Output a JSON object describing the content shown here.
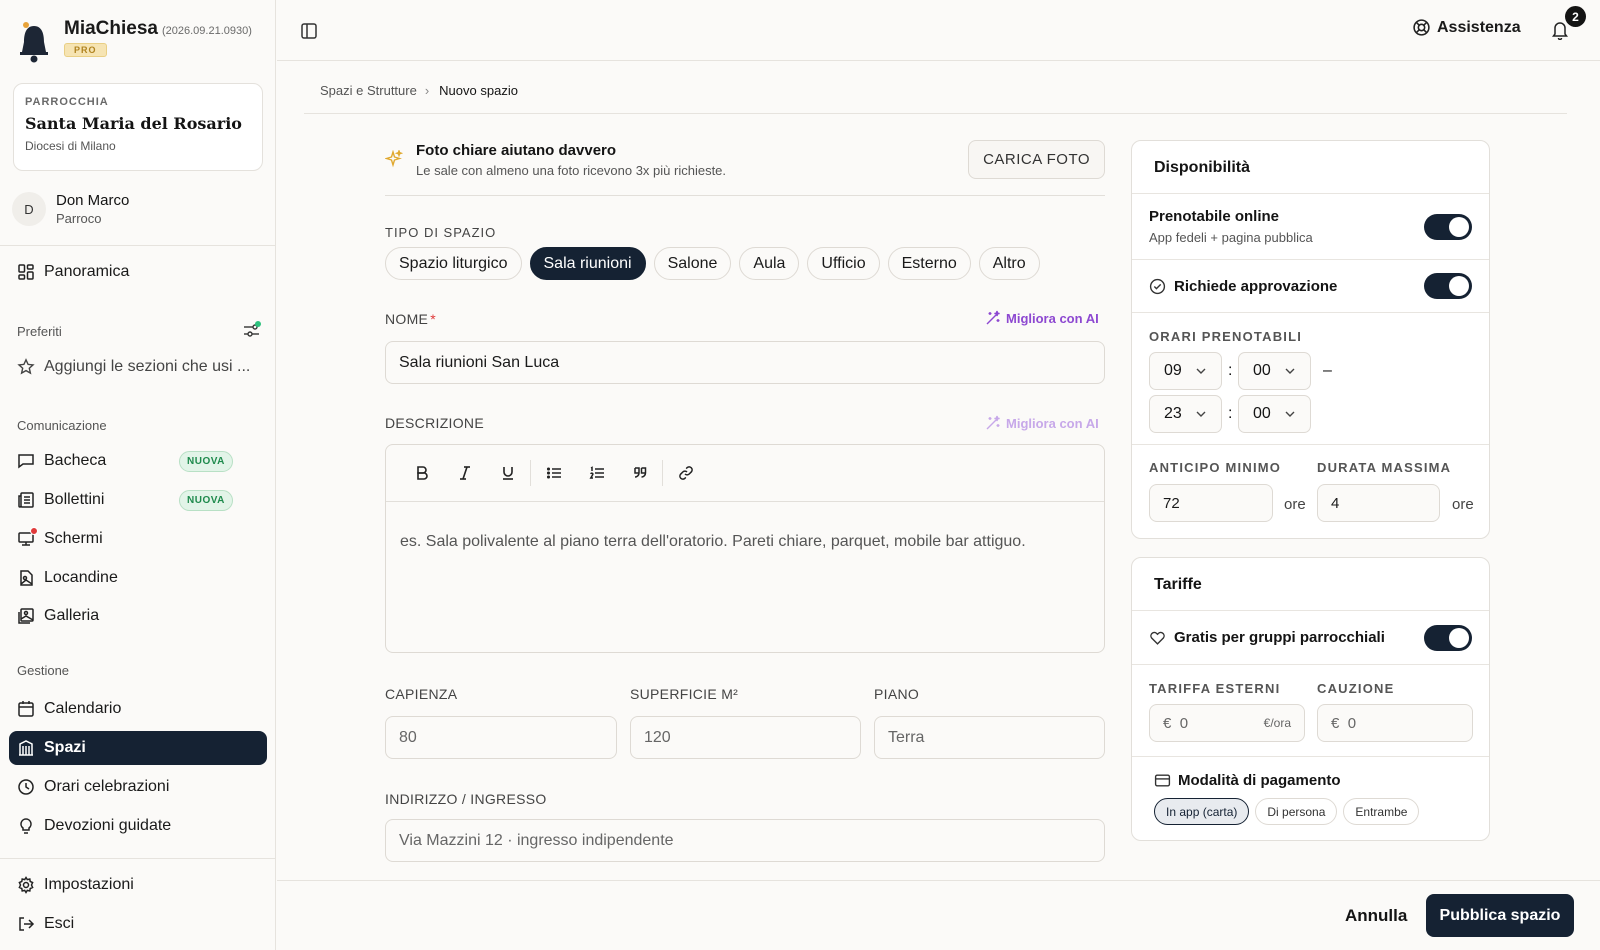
{
  "app": {
    "name": "MiaChiesa",
    "version": "(2026.09.21.0930)",
    "plan": "PRO"
  },
  "parish": {
    "label": "PARROCCHIA",
    "name": "Santa Maria del Rosario",
    "diocese": "Diocesi di Milano"
  },
  "user": {
    "initial": "D",
    "name": "Don Marco",
    "role": "Parroco"
  },
  "nav": {
    "overview": "Panoramica",
    "favorites_title": "Preferiti",
    "favorites_add": "Aggiungi le sezioni che usi ...",
    "communication_title": "Comunicazione",
    "communication": [
      {
        "label": "Bacheca",
        "badge": "NUOVA"
      },
      {
        "label": "Bollettini",
        "badge": "NUOVA"
      },
      {
        "label": "Schermi"
      },
      {
        "label": "Locandine"
      },
      {
        "label": "Galleria"
      }
    ],
    "management_title": "Gestione",
    "management": [
      "Calendario",
      "Spazi",
      "Orari celebrazioni",
      "Devozioni guidate"
    ],
    "settings": "Impostazioni",
    "logout": "Esci"
  },
  "topbar": {
    "help": "Assistenza",
    "notifications": "2"
  },
  "breadcrumb": {
    "parent": "Spazi e Strutture",
    "current": "Nuovo spazio"
  },
  "tip": {
    "title": "Foto chiare aiutano davvero",
    "text": "Le sale con almeno una foto ricevono 3x più richieste.",
    "button": "CARICA FOTO"
  },
  "form": {
    "type_label": "TIPO DI SPAZIO",
    "types": [
      "Spazio liturgico",
      "Sala riunioni",
      "Salone",
      "Aula",
      "Ufficio",
      "Esterno",
      "Altro"
    ],
    "selected_type": "Sala riunioni",
    "name_label": "NOME",
    "required_mark": "*",
    "ai_label": "Migliora con AI",
    "name_value": "Sala riunioni San Luca",
    "description_label": "DESCRIZIONE",
    "description_placeholder": "es. Sala polivalente al piano terra dell'oratorio. Pareti chiare, parquet, mobile bar attiguo.",
    "capacity_label": "CAPIENZA",
    "capacity_placeholder": "80",
    "area_label": "SUPERFICIE M²",
    "area_placeholder": "120",
    "floor_label": "PIANO",
    "floor_placeholder": "Terra",
    "address_label": "INDIRIZZO / INGRESSO",
    "address_placeholder": "Via Mazzini 12 · ingresso indipendente"
  },
  "availability": {
    "title": "Disponibilità",
    "online_title": "Prenotabile online",
    "online_sub": "App fedeli + pagina pubblica",
    "online_on": true,
    "approval": "Richiede approvazione",
    "approval_on": true,
    "hours_label": "ORARI PRENOTABILI",
    "from_h": "09",
    "from_m": "00",
    "dash": "–",
    "to_h": "23",
    "to_m": "00",
    "colon": ":",
    "min_advance_label": "ANTICIPO MINIMO",
    "min_advance": "72",
    "max_duration_label": "DURATA MASSIMA",
    "max_duration": "4",
    "unit": "ore"
  },
  "rates": {
    "title": "Tariffe",
    "free_groups": "Gratis per gruppi parrocchiali",
    "free_on": true,
    "external_label": "TARIFFA ESTERNI",
    "external_currency": "€",
    "external_placeholder": "0",
    "external_unit": "€/ora",
    "deposit_label": "CAUZIONE",
    "deposit_currency": "€",
    "deposit_placeholder": "0",
    "payment_label": "Modalità di pagamento",
    "payment_options": [
      "In app (carta)",
      "Di persona",
      "Entrambe"
    ],
    "payment_selected": "In app (carta)"
  },
  "actions": {
    "cancel": "Annulla",
    "publish": "Pubblica spazio"
  },
  "colors": {
    "primary": "#152233",
    "ai": "#8d48d1",
    "badge_green": "#1e8a4c",
    "notification_red": "#e03a3a",
    "pro_gold": "#b08320"
  }
}
